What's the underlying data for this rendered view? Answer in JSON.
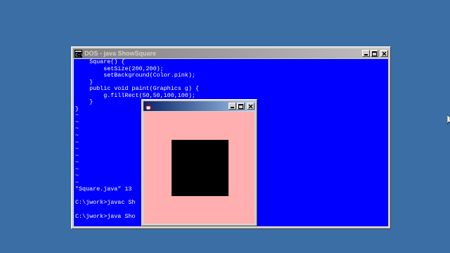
{
  "desktop": {
    "background": "#3a6ea5"
  },
  "dos_window": {
    "title": "DOS - java ShowSquare",
    "icon": "dos-prompt-icon",
    "controls": [
      "minimize-icon",
      "maximize-icon",
      "close-icon"
    ],
    "background": "#0000ff",
    "text_color": "#ffffff",
    "lines": [
      "    Square() {",
      "        setSize(200,200);",
      "        setBackground(Color.pink);",
      "    }",
      "    public void paint(Graphics g) {",
      "        g.fillRect(50,50,100,100);",
      "    }",
      "}",
      "~",
      "~",
      "~",
      "~",
      "~",
      "~",
      "~",
      "~",
      "~",
      "~",
      "~",
      "\"Square.java\" 13",
      "",
      "C:\\jwork>javac Sh",
      "",
      "C:\\jwork>java Sho"
    ]
  },
  "java_window": {
    "title": "",
    "icon": "java-cup-icon",
    "controls": [
      "minimize-icon",
      "maximize-icon",
      "close-icon"
    ],
    "background": "#ffafaf",
    "square_color": "#000000"
  }
}
